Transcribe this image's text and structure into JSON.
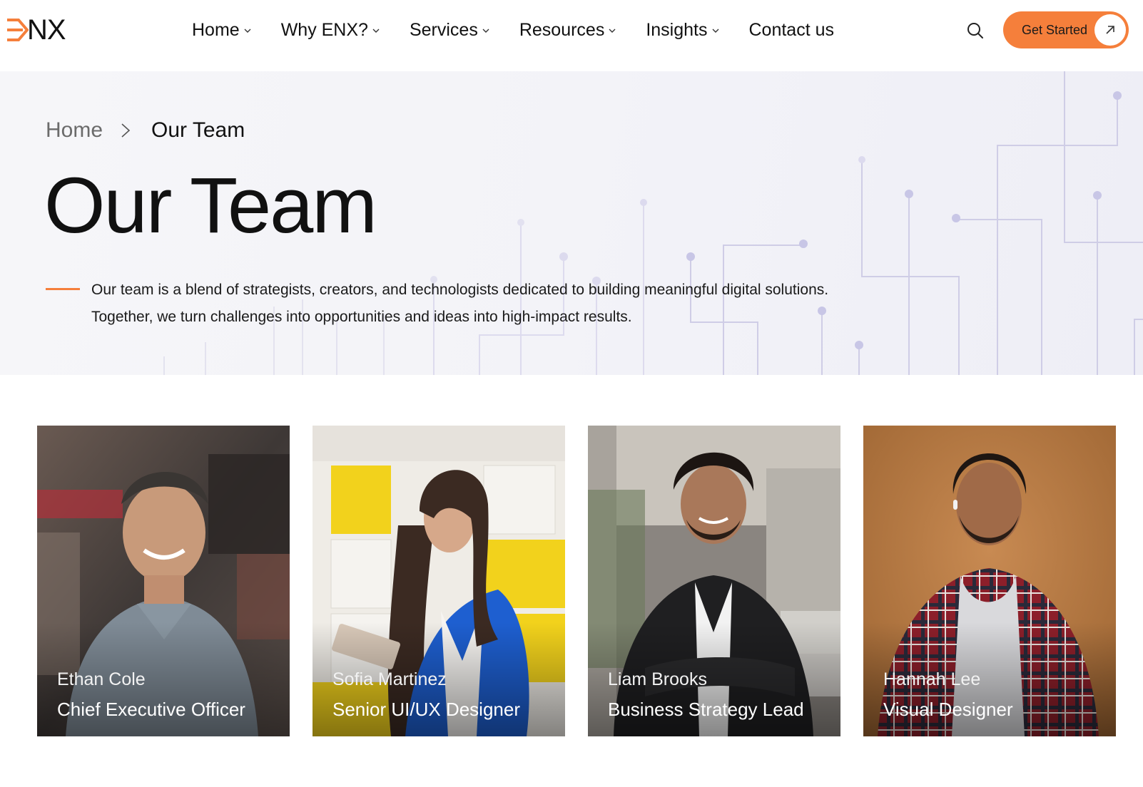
{
  "brand": {
    "logo_text": "NX",
    "accent_color": "#f57f3b"
  },
  "nav": {
    "items": [
      {
        "label": "Home",
        "has_dropdown": true
      },
      {
        "label": "Why ENX?",
        "has_dropdown": true
      },
      {
        "label": "Services",
        "has_dropdown": true
      },
      {
        "label": "Resources",
        "has_dropdown": true
      },
      {
        "label": "Insights",
        "has_dropdown": true
      },
      {
        "label": "Contact us",
        "has_dropdown": false
      }
    ],
    "search_icon": "search-icon",
    "cta_label": "Get Started",
    "cta_icon": "arrow-up-right-icon"
  },
  "hero": {
    "breadcrumb": {
      "home": "Home",
      "current": "Our Team"
    },
    "title": "Our Team",
    "intro_line1": "Our team is a blend of strategists, creators, and technologists dedicated to building meaningful digital solutions.",
    "intro_line2": "Together, we turn challenges into opportunities and ideas into high-impact results."
  },
  "team": [
    {
      "name": "Ethan Cole",
      "role": "Chief Executive Officer"
    },
    {
      "name": "Sofia Martinez",
      "role": "Senior UI/UX Designer"
    },
    {
      "name": "Liam Brooks",
      "role": "Business Strategy Lead"
    },
    {
      "name": "Hannah Lee",
      "role": "Visual Designer"
    }
  ]
}
